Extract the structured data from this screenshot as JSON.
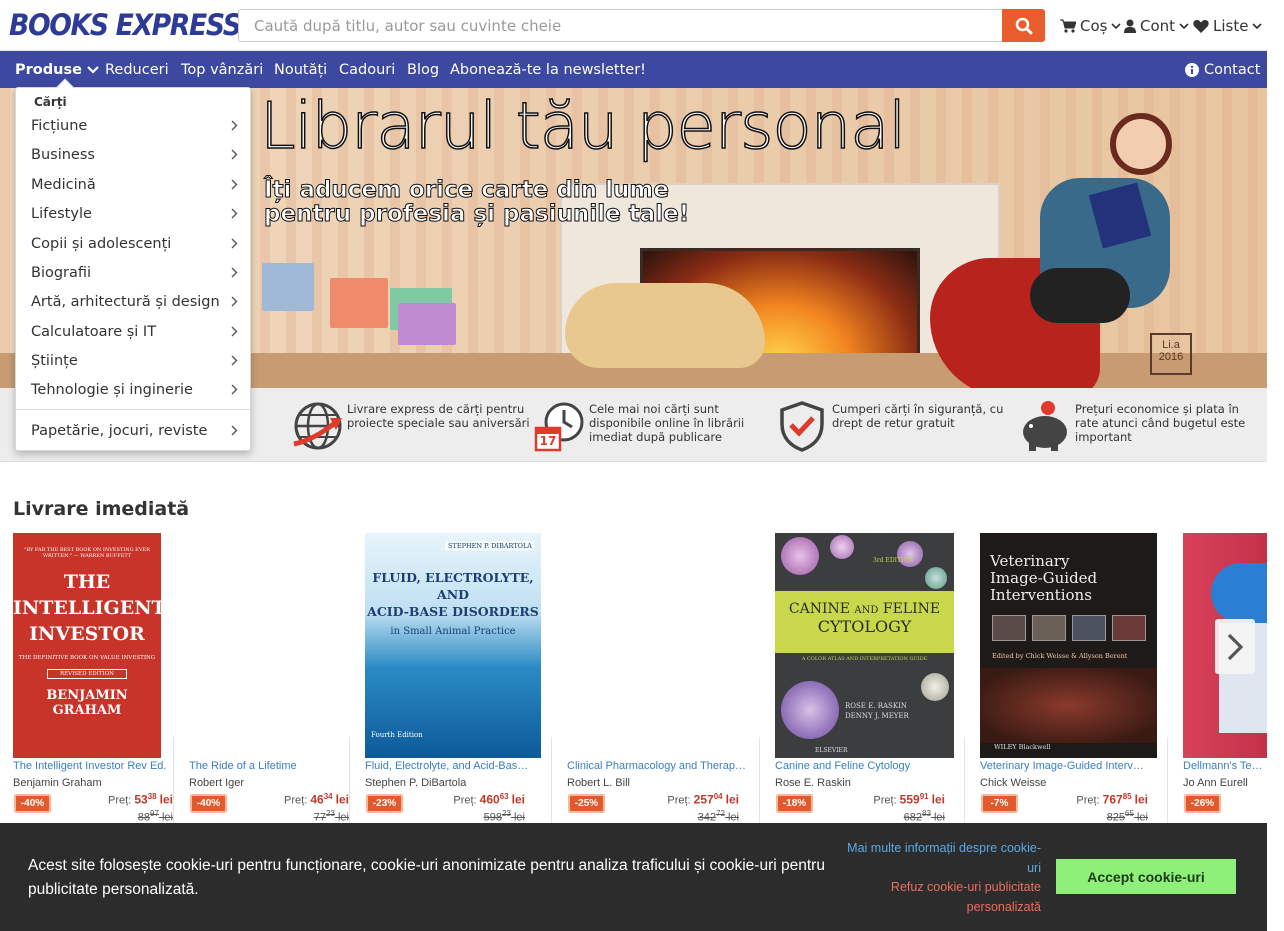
{
  "header": {
    "logo": "BOOKS EXPRESS",
    "search_placeholder": "Caută după titlu, autor sau cuvinte cheie",
    "cart_label": "Coș",
    "account_label": "Cont",
    "lists_label": "Liste"
  },
  "nav": {
    "products": "Produse",
    "items": [
      "Reduceri",
      "Top vânzări",
      "Noutăți",
      "Cadouri",
      "Blog",
      "Abonează-te la newsletter!"
    ],
    "contact": "Contact"
  },
  "dropdown": {
    "heading": "Cărți",
    "items": [
      "Ficțiune",
      "Business",
      "Medicină",
      "Lifestyle",
      "Copii și adolescenți",
      "Biografii",
      "Artă, arhitectură și design",
      "Calculatoare și IT",
      "Științe",
      "Tehnologie și inginerie"
    ],
    "extra": "Papetărie, jocuri, reviste"
  },
  "hero": {
    "title": "Librarul tău personal",
    "subtitle_1": "Îți aducem orice carte din lume",
    "subtitle_2": "pentru profesia și pasiunile tale!",
    "signature": "Li.a 2016"
  },
  "features": [
    {
      "icon": "globe-delivery-icon",
      "text": "Livrare express de cărți pentru proiecte speciale sau aniversări"
    },
    {
      "icon": "clock-calendar-icon",
      "text": "Cele mai noi cărți sunt disponibile online în librării imediat după publicare",
      "calendar_day": "17"
    },
    {
      "icon": "shield-check-icon",
      "text": "Cumperi cărți în siguranță, cu drept de retur gratuit"
    },
    {
      "icon": "piggy-bank-icon",
      "text": "Prețuri economice și plata în rate atunci când bugetul este important"
    }
  ],
  "section": {
    "title": "Livrare imediată",
    "price_label": "Preț:",
    "currency": "lei",
    "books": [
      {
        "title": "The Intelligent Investor Rev Ed.",
        "author": "Benjamin Graham",
        "discount": "-40%",
        "price_int": "53",
        "price_dec": "38",
        "old_int": "88",
        "old_dec": "97",
        "cover": {
          "quote": "\"BY FAR THE BEST BOOK ON INVESTING EVER WRITTEN.\" — WARREN BUFFETT",
          "line1": "THE",
          "line2": "INTELLIGENT",
          "line3": "INVESTOR",
          "tagline": "THE DEFINITIVE BOOK ON VALUE INVESTING",
          "edition": "REVISED EDITION",
          "author": "BENJAMIN GRAHAM"
        }
      },
      {
        "title": "The Ride of a Lifetime",
        "author": "Robert Iger",
        "discount": "-40%",
        "price_int": "46",
        "price_dec": "34",
        "old_int": "77",
        "old_dec": "23"
      },
      {
        "title": "Fluid, Electrolyte, and Acid-Base Disorders in Small Animal Practice",
        "author": "Stephen P. DiBartola",
        "discount": "-23%",
        "price_int": "460",
        "price_dec": "63",
        "old_int": "598",
        "old_dec": "23",
        "cover": {
          "author": "STEPHEN P. DIBARTOLA",
          "line1": "FLUID, ELECTROLYTE,",
          "line2": "AND",
          "line3": "ACID-BASE DISORDERS",
          "line4": "in Small Animal Practice",
          "edition": "Fourth Edition"
        }
      },
      {
        "title": "Clinical Pharmacology and Therapeutics for Veterinary Technicians",
        "author": "Robert L. Bill",
        "discount": "-25%",
        "price_int": "257",
        "price_dec": "04",
        "old_int": "342",
        "old_dec": "72"
      },
      {
        "title": "Canine and Feline Cytology",
        "author": "Rose E. Raskin",
        "discount": "-18%",
        "price_int": "559",
        "price_dec": "91",
        "old_int": "682",
        "old_dec": "83",
        "cover": {
          "edition": "3rd EDITION",
          "line1": "CANINE and FELINE",
          "line2": "CYTOLOGY",
          "tagline": "A COLOR ATLAS AND INTERPRETATION GUIDE",
          "author1": "ROSE E. RASKIN",
          "author2": "DENNY J. MEYER",
          "publisher": "ELSEVIER"
        }
      },
      {
        "title": "Veterinary Image-Guided Interventions",
        "author": "Chick Weisse",
        "discount": "-7%",
        "price_int": "767",
        "price_dec": "85",
        "old_int": "825",
        "old_dec": "65",
        "cover": {
          "line1": "Veterinary",
          "line2": "Image-Guided",
          "line3": "Interventions",
          "editors": "Edited by Chick Weisse & Allyson Berent",
          "publisher": "WILEY Blackwell"
        }
      },
      {
        "title": "Dellmann's Textbook of Veterinary Histology",
        "author": "Jo Ann Eurell",
        "discount": "-26%"
      }
    ]
  },
  "cookie": {
    "message": "Acest site folosește cookie-uri pentru funcționare, cookie-uri anonimizate pentru analiza traficului și cookie-uri pentru publicitate personalizată.",
    "more": "Mai multe informații despre cookie-uri",
    "refuse": "Refuz cookie-uri publicitate personalizată",
    "accept": "Accept cookie-uri"
  },
  "colors": {
    "brand": "#3d48a1",
    "accent": "#e85d2b",
    "accept": "#8ef078"
  }
}
